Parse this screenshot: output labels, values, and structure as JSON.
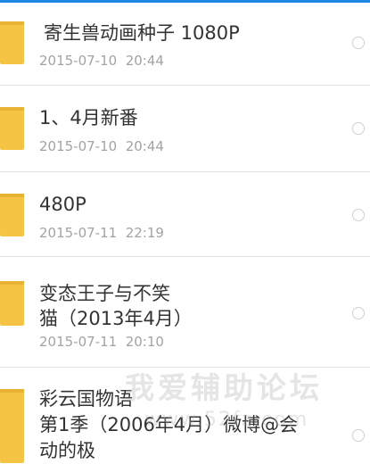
{
  "files": [
    {
      "name": "寄生兽动画种子 1080P",
      "date": "2015-07-10  20:44",
      "icon": "folder-icon"
    },
    {
      "name": "1、4月新番",
      "date": "2015-07-10  20:44",
      "icon": "folder-icon"
    },
    {
      "name": "480P",
      "date": "2015-07-11  22:19",
      "icon": "folder-icon"
    },
    {
      "name": "变态王子与不笑\n猫（2013年4月）",
      "date": "2015-07-11  20:10",
      "icon": "folder-icon"
    },
    {
      "name": "彩云国物语\n第1季（2006年4月）微博@会\n动的极",
      "date": "",
      "icon": "folder-icon"
    }
  ],
  "watermark": {
    "title": "我爱辅助论坛",
    "url": "www.52fz.com"
  },
  "colors": {
    "folder": "#f6c444",
    "folder_tab": "#e9b233",
    "accent": "#1e88e5",
    "date_text": "#a3a3a3",
    "name_text": "#333333"
  }
}
